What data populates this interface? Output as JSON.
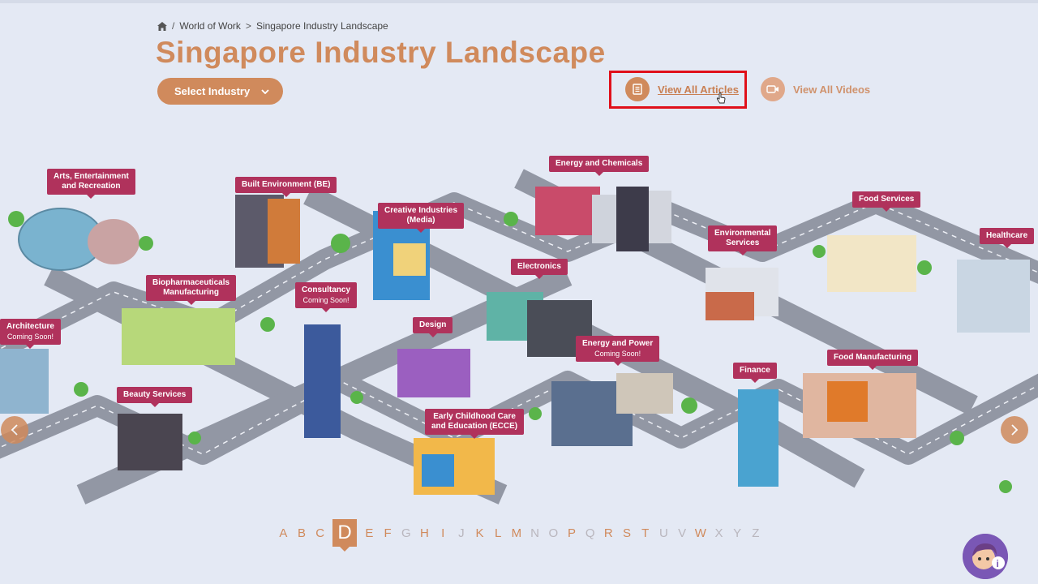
{
  "breadcrumb": {
    "home_icon": "home-icon",
    "separator": "/",
    "separator2": ">",
    "items": [
      "World of Work",
      "Singapore Industry Landscape"
    ]
  },
  "page": {
    "title": "Singapore Industry Landscape"
  },
  "controls": {
    "select_industry": "Select Industry",
    "view_articles": "View All Articles",
    "view_videos": "View All Videos"
  },
  "industries": {
    "arts": {
      "line1": "Arts, Entertainment",
      "line2": "and Recreation"
    },
    "built": {
      "line1": "Built Environment (BE)"
    },
    "creative": {
      "line1": "Creative Industries",
      "line2": "(Media)"
    },
    "energy_chem": {
      "line1": "Energy and Chemicals"
    },
    "food_services": {
      "line1": "Food Services"
    },
    "healthcare": {
      "line1": "Healthcare"
    },
    "environmental": {
      "line1": "Environmental",
      "line2": "Services"
    },
    "electronics": {
      "line1": "Electronics"
    },
    "biopharma": {
      "line1": "Biopharmaceuticals",
      "line2": "Manufacturing"
    },
    "consultancy": {
      "line1": "Consultancy",
      "soon": "Coming Soon!"
    },
    "architecture": {
      "line1": "Architecture",
      "soon": "Coming Soon!"
    },
    "design": {
      "line1": "Design"
    },
    "energy_power": {
      "line1": "Energy and Power",
      "soon": "Coming Soon!"
    },
    "finance": {
      "line1": "Finance"
    },
    "food_manufacturing": {
      "line1": "Food Manufacturing"
    },
    "beauty": {
      "line1": "Beauty Services"
    },
    "ecce": {
      "line1": "Early Childhood Care",
      "line2": "and Education (ECCE)"
    }
  },
  "alphabet": {
    "letters": [
      "A",
      "B",
      "C",
      "D",
      "E",
      "F",
      "G",
      "H",
      "I",
      "J",
      "K",
      "L",
      "M",
      "N",
      "O",
      "P",
      "Q",
      "R",
      "S",
      "T",
      "U",
      "V",
      "W",
      "X",
      "Y",
      "Z"
    ],
    "active": "D",
    "dim": [
      "G",
      "J",
      "N",
      "O",
      "Q",
      "U",
      "V",
      "X",
      "Y",
      "Z"
    ]
  },
  "colors": {
    "accent": "#d08a5c",
    "label": "#b0325c",
    "highlight": "#e0101a"
  }
}
